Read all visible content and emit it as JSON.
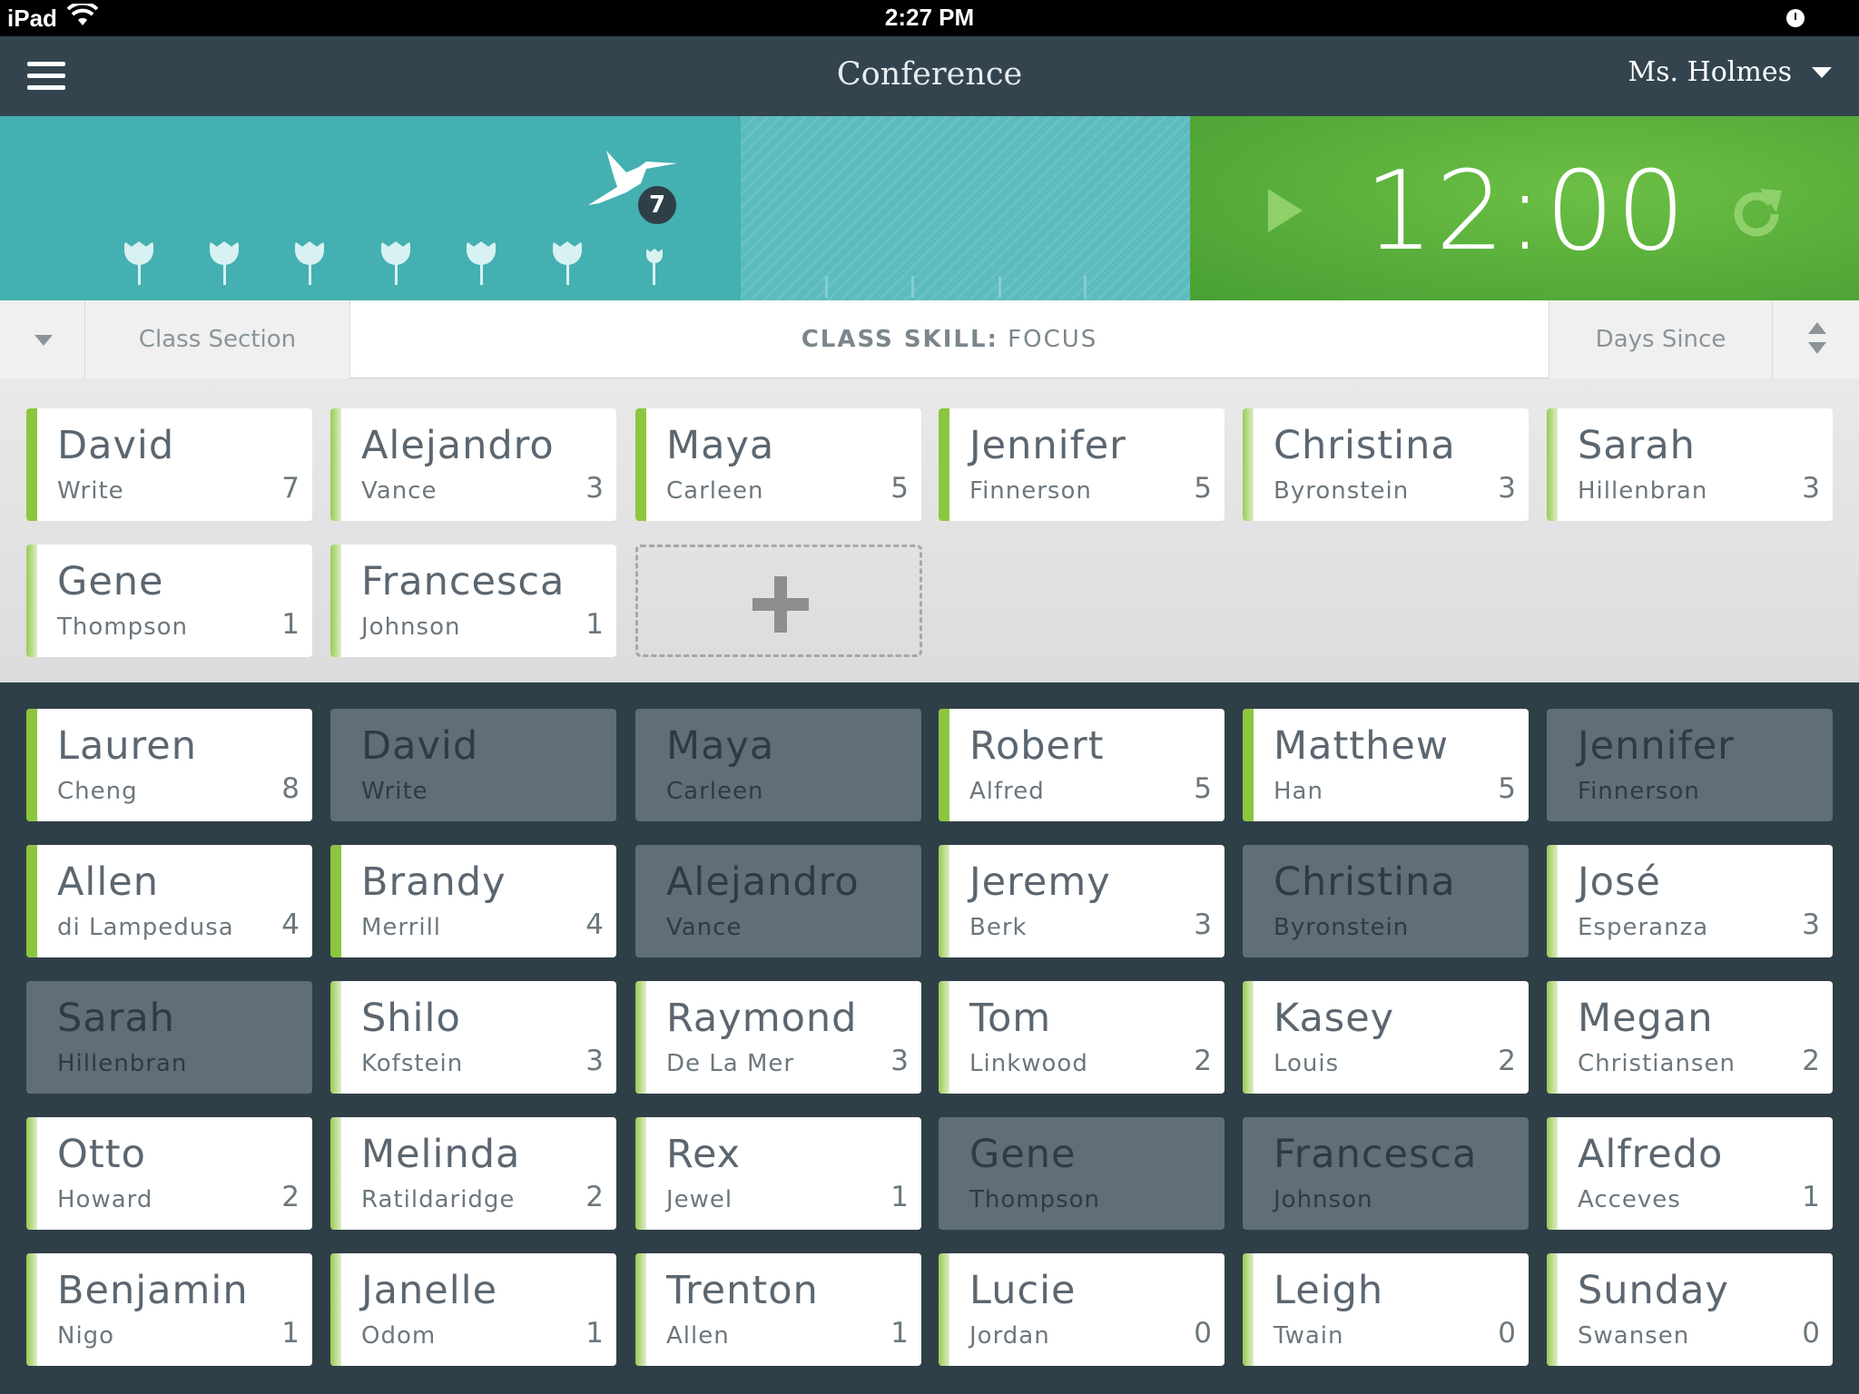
{
  "status_bar": {
    "device": "iPad",
    "time": "2:27 PM"
  },
  "nav": {
    "title": "Conference",
    "user": "Ms. Holmes"
  },
  "progress": {
    "badge": "7",
    "flowers_filled": 6
  },
  "timer": {
    "display": "12:00"
  },
  "filter": {
    "section_label": "Class Section",
    "skill_prefix": "CLASS SKILL:",
    "skill_value": " FOCUS",
    "days_label": "Days Since"
  },
  "colors": {
    "teal": "#44b0b1",
    "green": "#5cb33c",
    "bar_strong": "#8cc63f",
    "bar_light": "#dcebc4"
  },
  "selected": [
    {
      "first": "David",
      "last": "Write",
      "count": "7"
    },
    {
      "first": "Alejandro",
      "last": "Vance",
      "count": "3"
    },
    {
      "first": "Maya",
      "last": "Carleen",
      "count": "5"
    },
    {
      "first": "Jennifer",
      "last": "Finnerson",
      "count": "5"
    },
    {
      "first": "Christina",
      "last": "Byronstein",
      "count": "3"
    },
    {
      "first": "Sarah",
      "last": "Hillenbran",
      "count": "3"
    },
    {
      "first": "Gene",
      "last": "Thompson",
      "count": "1"
    },
    {
      "first": "Francesca",
      "last": "Johnson",
      "count": "1"
    }
  ],
  "roster": [
    {
      "first": "Lauren",
      "last": "Cheng",
      "count": "8"
    },
    {
      "first": "David",
      "last": "Write",
      "count": ""
    },
    {
      "first": "Maya",
      "last": "Carleen",
      "count": ""
    },
    {
      "first": "Robert",
      "last": "Alfred",
      "count": "5"
    },
    {
      "first": "Matthew",
      "last": "Han",
      "count": "5"
    },
    {
      "first": "Jennifer",
      "last": "Finnerson",
      "count": ""
    },
    {
      "first": "Allen",
      "last": "di Lampedusa",
      "count": "4"
    },
    {
      "first": "Brandy",
      "last": "Merrill",
      "count": "4"
    },
    {
      "first": "Alejandro",
      "last": "Vance",
      "count": ""
    },
    {
      "first": "Jeremy",
      "last": "Berk",
      "count": "3"
    },
    {
      "first": "Christina",
      "last": "Byronstein",
      "count": ""
    },
    {
      "first": "José",
      "last": "Esperanza",
      "count": "3"
    },
    {
      "first": "Sarah",
      "last": "Hillenbran",
      "count": ""
    },
    {
      "first": "Shilo",
      "last": "Kofstein",
      "count": "3"
    },
    {
      "first": "Raymond",
      "last": "De La Mer",
      "count": "3"
    },
    {
      "first": "Tom",
      "last": "Linkwood",
      "count": "2"
    },
    {
      "first": "Kasey",
      "last": "Louis",
      "count": "2"
    },
    {
      "first": "Megan",
      "last": "Christiansen",
      "count": "2"
    },
    {
      "first": "Otto",
      "last": "Howard",
      "count": "2"
    },
    {
      "first": "Melinda",
      "last": "Ratildaridge",
      "count": "2"
    },
    {
      "first": "Rex",
      "last": "Jewel",
      "count": "1"
    },
    {
      "first": "Gene",
      "last": "Thompson",
      "count": ""
    },
    {
      "first": "Francesca",
      "last": "Johnson",
      "count": ""
    },
    {
      "first": "Alfredo",
      "last": "Acceves",
      "count": "1"
    },
    {
      "first": "Benjamin",
      "last": "Nigo",
      "count": "1"
    },
    {
      "first": "Janelle",
      "last": "Odom",
      "count": "1"
    },
    {
      "first": "Trenton",
      "last": "Allen",
      "count": "1"
    },
    {
      "first": "Lucie",
      "last": "Jordan",
      "count": "0"
    },
    {
      "first": "Leigh",
      "last": "Twain",
      "count": "0"
    },
    {
      "first": "Sunday",
      "last": "Swansen",
      "count": "0"
    }
  ]
}
